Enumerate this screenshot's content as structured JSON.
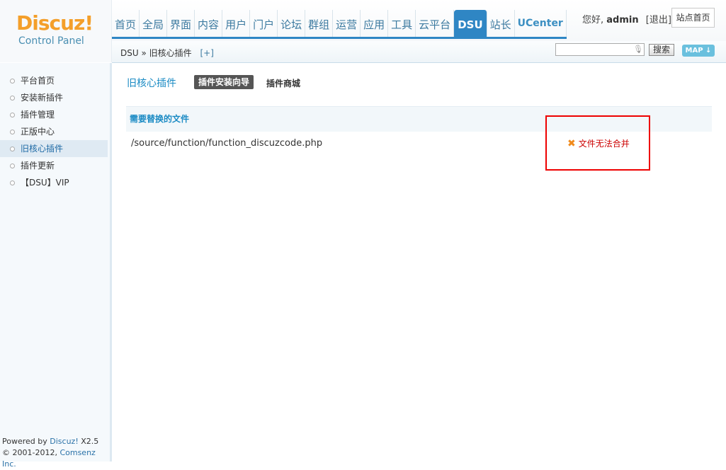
{
  "logo": {
    "main": "Discuz!",
    "sub": "Control Panel"
  },
  "topnav": [
    {
      "label": "首页"
    },
    {
      "label": "全局"
    },
    {
      "label": "界面"
    },
    {
      "label": "内容"
    },
    {
      "label": "用户"
    },
    {
      "label": "门户"
    },
    {
      "label": "论坛"
    },
    {
      "label": "群组"
    },
    {
      "label": "运营"
    },
    {
      "label": "应用"
    },
    {
      "label": "工具"
    },
    {
      "label": "云平台"
    },
    {
      "label": "DSU",
      "active": true
    },
    {
      "label": "站长"
    },
    {
      "label": "UCenter"
    }
  ],
  "user": {
    "greeting": "您好,",
    "name": "admin",
    "logout": "[退出]",
    "site_home": "站点首页"
  },
  "breadcrumb": {
    "root": "DSU",
    "sep": "»",
    "current": "旧核心插件",
    "add": "[+]"
  },
  "search": {
    "placeholder": "",
    "button": "搜索",
    "map": "MAP ↓"
  },
  "sidebar": {
    "items": [
      {
        "label": "平台首页"
      },
      {
        "label": "安装新插件"
      },
      {
        "label": "插件管理"
      },
      {
        "label": "正版中心"
      },
      {
        "label": "旧核心插件",
        "active": true
      },
      {
        "label": "插件更新"
      },
      {
        "label": "【DSU】VIP"
      }
    ],
    "footer": {
      "powered": "Powered by",
      "brand": "Discuz!",
      "version": "X2.5",
      "copy": "© 2001-2012,",
      "company": "Comsenz Inc."
    }
  },
  "main": {
    "title": "旧核心插件",
    "tab_wizard": "插件安装向导",
    "tab_store": "插件商城",
    "table_header": "需要替换的文件",
    "rows": [
      {
        "path": "/source/function/function_discuzcode.php",
        "status": "文件无法合并"
      }
    ]
  },
  "colors": {
    "accent": "#2f86c4",
    "logo": "#f49f2a",
    "error": "#cc0000",
    "highlight": "#ee0000"
  }
}
